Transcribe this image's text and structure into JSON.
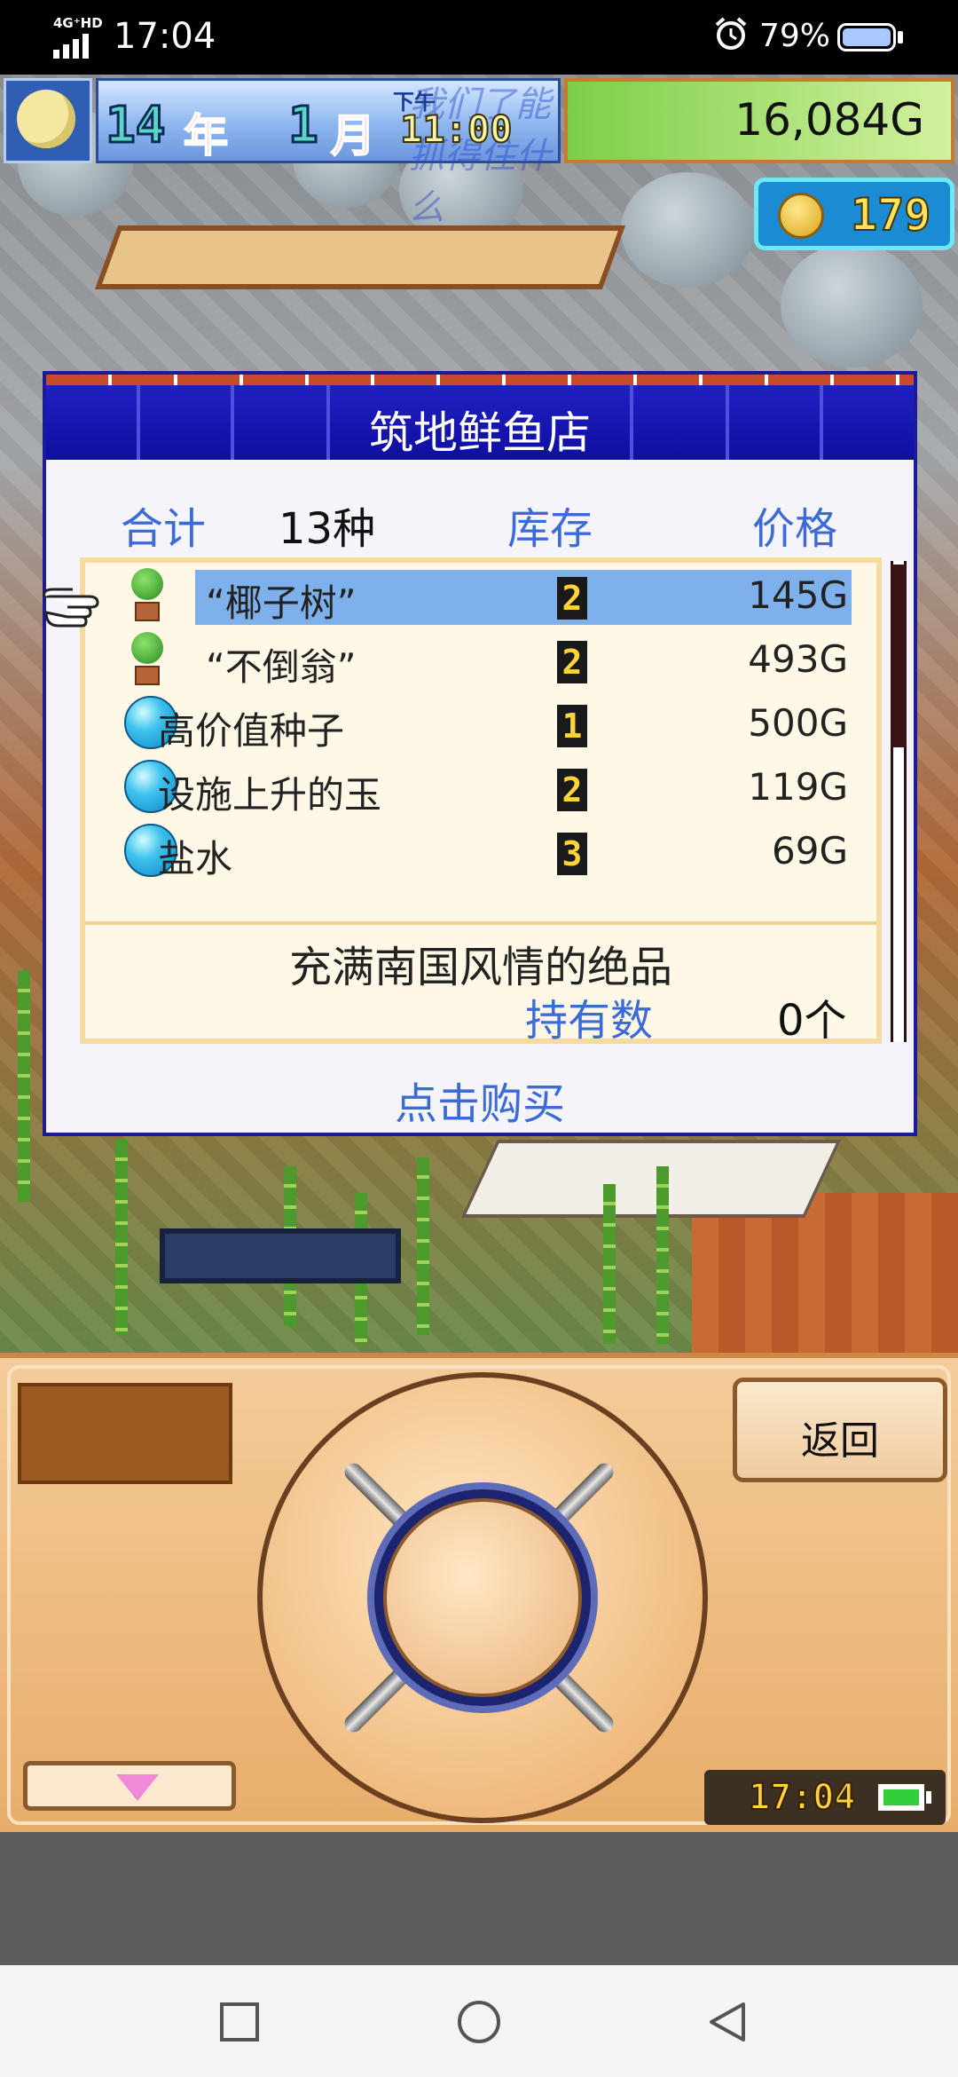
{
  "status_bar": {
    "network": "4G⁺HD",
    "time": "17:04",
    "battery_percent": "79%"
  },
  "hud": {
    "year_num": "14",
    "year_unit": "年",
    "month_num": "1",
    "month_unit": "月",
    "ampm": "下午",
    "clock": "11:00",
    "watermark": "我们了能抓得住什么",
    "money": "16,084G",
    "coins": "179"
  },
  "shop": {
    "title": "筑地鲜鱼店",
    "total_label": "合计",
    "total_value": "13种",
    "stock_label": "库存",
    "price_label": "价格",
    "items": [
      {
        "name": "“椰子树”",
        "stock": "2",
        "price": "145G",
        "icon": "potted-tree-icon",
        "selected": true
      },
      {
        "name": "“不倒翁”",
        "stock": "2",
        "price": "493G",
        "icon": "potted-tree-icon",
        "selected": false
      },
      {
        "name": "高价值种子",
        "stock": "1",
        "price": "500G",
        "icon": "blue-orb-icon",
        "selected": false
      },
      {
        "name": "设施上升的玉",
        "stock": "2",
        "price": "119G",
        "icon": "blue-orb-icon",
        "selected": false
      },
      {
        "name": "盐水",
        "stock": "3",
        "price": "69G",
        "icon": "blue-orb-icon",
        "selected": false
      }
    ],
    "description": "充满南国风情的绝品",
    "owned_label": "持有数",
    "owned_value": "0个",
    "buy_label": "点击购买"
  },
  "controls": {
    "back_label": "返回",
    "game_clock": "17:04"
  },
  "colors": {
    "dialog_title_blue": "#1515b4",
    "label_blue": "#3c6ad6",
    "selection_blue": "#7eb1ec",
    "panel_tan": "#f4cc9a"
  }
}
